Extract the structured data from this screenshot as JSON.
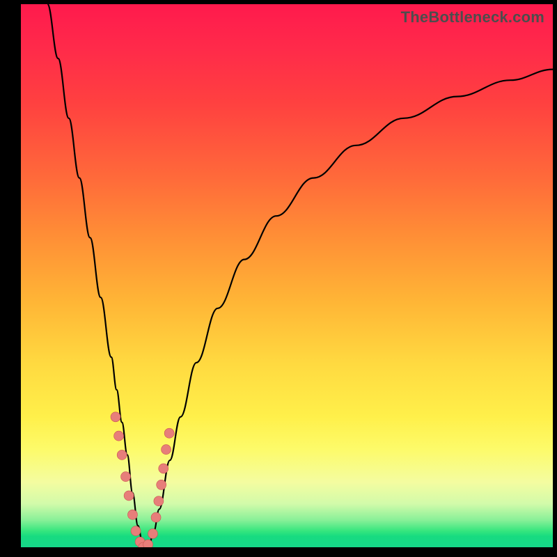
{
  "watermark": "TheBottleneck.com",
  "colors": {
    "frame_bg": "#000000",
    "curve_stroke": "#000000",
    "marker_fill": "#e77e7a",
    "marker_stroke": "#c9534f"
  },
  "chart_data": {
    "type": "line",
    "title": "",
    "xlabel": "",
    "ylabel": "",
    "xlim": [
      0,
      100
    ],
    "ylim": [
      0,
      100
    ],
    "grid": false,
    "legend": false,
    "series": [
      {
        "name": "bottleneck-curve",
        "x": [
          5,
          7,
          9,
          11,
          13,
          15,
          17,
          18,
          19,
          20,
          21,
          22,
          23,
          24,
          25,
          26,
          28,
          30,
          33,
          37,
          42,
          48,
          55,
          63,
          72,
          82,
          92,
          100
        ],
        "values": [
          100,
          90,
          79,
          68,
          57,
          46,
          35,
          29,
          23,
          17,
          10,
          4,
          0,
          0,
          3,
          7,
          16,
          24,
          34,
          44,
          53,
          61,
          68,
          74,
          79,
          83,
          86,
          88
        ]
      }
    ],
    "markers": {
      "name": "highlighted-points",
      "x": [
        17.8,
        18.4,
        19.0,
        19.7,
        20.3,
        21.0,
        21.6,
        22.4,
        23.0,
        23.9,
        24.8,
        25.4,
        25.9,
        26.4,
        26.8,
        27.3,
        27.9
      ],
      "values": [
        24,
        20.5,
        17,
        13,
        9.5,
        6,
        3,
        1,
        0,
        0.5,
        2.5,
        5.5,
        8.5,
        11.5,
        14.5,
        18,
        21
      ],
      "radius": 7
    }
  }
}
